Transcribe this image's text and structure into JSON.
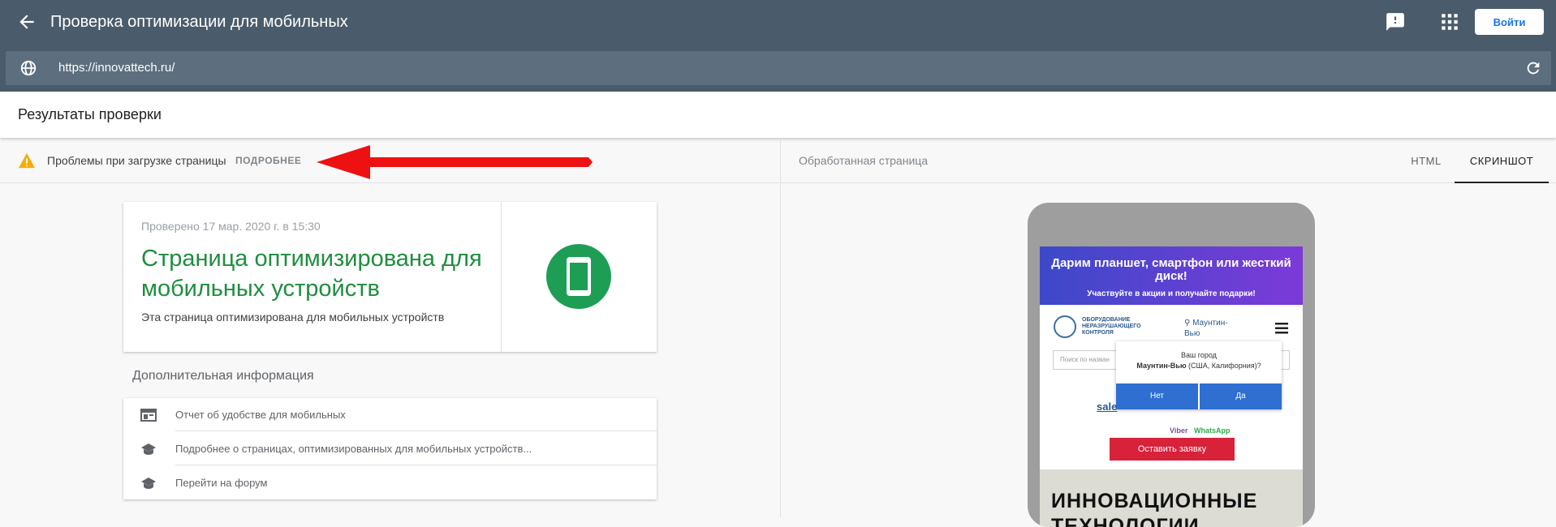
{
  "header": {
    "title": "Проверка оптимизации для мобильных",
    "login_label": "Войти"
  },
  "urlbar": {
    "url": "https://innovattech.ru/"
  },
  "results": {
    "title": "Результаты проверки"
  },
  "issue": {
    "text": "Проблемы при загрузке страницы",
    "more_label": "ПОДРОБНЕЕ"
  },
  "summary": {
    "checked": "Проверено 17 мар. 2020 г. в 15:30",
    "headline": "Страница оптимизирована для мобильных устройств",
    "description": "Эта страница оптимизирована для мобильных устройств",
    "status_color": "#1e8e3e"
  },
  "additional": {
    "title": "Дополнительная информация",
    "links": [
      {
        "icon": "web-report-icon",
        "label": "Отчет об удобстве для мобильных"
      },
      {
        "icon": "school-icon",
        "label": "Подробнее о страницах, оптимизированных для мобильных устройств..."
      },
      {
        "icon": "school-icon",
        "label": "Перейти на форум"
      }
    ]
  },
  "preview": {
    "label": "Обработанная страница",
    "tabs": [
      {
        "label": "HTML",
        "active": false
      },
      {
        "label": "СКРИНШОТ",
        "active": true
      }
    ]
  },
  "mobile_screenshot": {
    "promo_title": "Дарим планшет, смартфон или жесткий диск!",
    "promo_sub": "Участвуйте в акции и получайте подарки!",
    "logo_text": "ОБОРУДОВАНИЕ НЕРАЗРУШАЮЩЕГО КОНТРОЛЯ",
    "city_link": "Маунтин-Вью",
    "search_placeholder": "Поиск по назван",
    "popup_line1": "Ваш город",
    "popup_city": "Маунтин-Вью",
    "popup_region": " (США, Калифорния)?",
    "popup_no": "Нет",
    "popup_yes": "Да",
    "sale_text": "sale",
    "viber": "Viber",
    "whatsapp": "WhatsApp",
    "order_button": "Оставить заявку",
    "hero_heading": "ИННОВАЦИОННЫЕ ТЕХНОЛОГИИ"
  }
}
